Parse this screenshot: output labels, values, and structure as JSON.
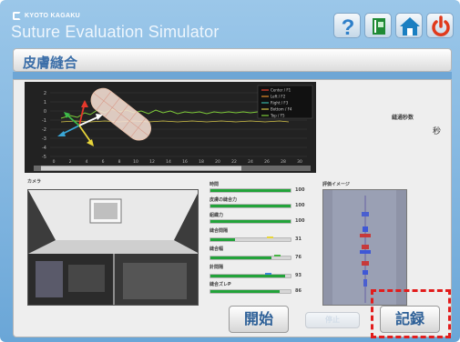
{
  "header": {
    "brand": "KYOTO KAGAKU",
    "app_title": "Suture Evaluation Simulator",
    "buttons": [
      {
        "name": "help",
        "icon": "question-mark-icon",
        "label": "?"
      },
      {
        "name": "manual",
        "icon": "book-icon"
      },
      {
        "name": "home",
        "icon": "home-icon"
      },
      {
        "name": "power",
        "icon": "power-icon"
      }
    ]
  },
  "screen_title": "皮膚縫合",
  "chart": {
    "legend": [
      "Center / F1",
      "Left / F2",
      "Right / F3",
      "Bottom / F4",
      "Top / F5"
    ],
    "legend_colors": [
      "#e8412e",
      "#e58d2b",
      "#38b5a6",
      "#d6c64a",
      "#7fcc3a"
    ],
    "y_ticks": [
      "2",
      "1",
      "0",
      "-1",
      "-2",
      "-3",
      "-4",
      "-5"
    ],
    "x_ticks": [
      "0",
      "2",
      "4",
      "6",
      "8",
      "10",
      "12",
      "14",
      "16",
      "18",
      "20",
      "22",
      "24",
      "26",
      "28",
      "30"
    ],
    "segment_label": "縫通秒数",
    "segment_unit": "秒"
  },
  "camera_label": "カメラ",
  "metrics": [
    {
      "label": "時間",
      "value": "100",
      "fill": 1.0
    },
    {
      "label": "皮膚の縫合力",
      "value": "100",
      "fill": 1.0
    },
    {
      "label": "組織力",
      "value": "100",
      "fill": 1.0
    },
    {
      "label": "縫合間隔",
      "value": "31",
      "fill": 0.31,
      "marker_color": "#e8d53a",
      "marker_pos": 0.7
    },
    {
      "label": "縫合幅",
      "value": "76",
      "fill": 0.76,
      "marker_color": "#45b442",
      "marker_pos": 0.8
    },
    {
      "label": "針間隔",
      "value": "93",
      "fill": 0.93,
      "marker_color": "#3a82d6",
      "marker_pos": 0.68
    },
    {
      "label": "縫合ズレP",
      "value": "86",
      "fill": 0.86
    }
  ],
  "eval_label": "評価イメージ",
  "buttons": {
    "start": "開始",
    "stop": "停止",
    "record": "記録"
  },
  "colors": {
    "accent": "#3b6ea8",
    "highlight": "#e21c1c",
    "bar_green": "#22a33a"
  }
}
